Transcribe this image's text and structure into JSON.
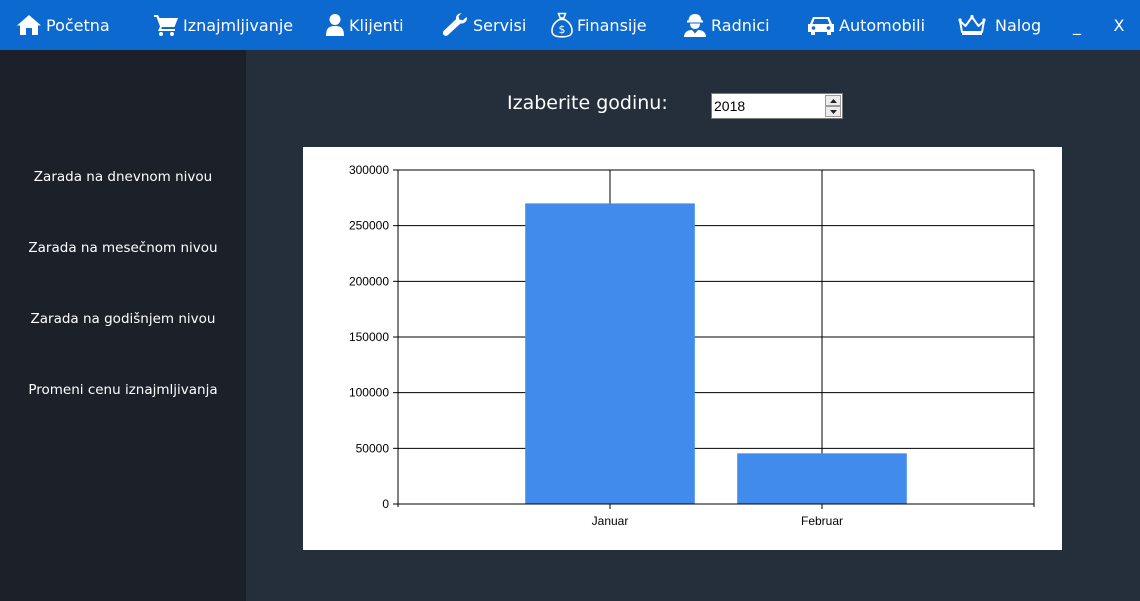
{
  "navbar": {
    "items": [
      {
        "label": "Početna",
        "icon": "home-icon"
      },
      {
        "label": "Iznajmljivanje",
        "icon": "cart-icon"
      },
      {
        "label": "Klijenti",
        "icon": "user-icon"
      },
      {
        "label": "Servisi",
        "icon": "wrench-icon"
      },
      {
        "label": "Finansije",
        "icon": "money-bag-icon"
      },
      {
        "label": "Radnici",
        "icon": "worker-icon"
      },
      {
        "label": "Automobili",
        "icon": "car-icon"
      },
      {
        "label": "Nalog",
        "icon": "crown-icon"
      }
    ],
    "minimize": "_",
    "close": "X",
    "color": "#0b69cf"
  },
  "sidebar": {
    "items": [
      {
        "label": "Zarada na dnevnom nivou"
      },
      {
        "label": "Zarada na mesečnom nivou"
      },
      {
        "label": "Zarada na godišnjem nivou"
      },
      {
        "label": "Promeni cenu iznajmljivanja"
      }
    ]
  },
  "year_selector": {
    "label": "Izaberite godinu:",
    "value": "2018"
  },
  "chart_data": {
    "type": "bar",
    "categories": [
      "Januar",
      "Februar"
    ],
    "values": [
      270000,
      45500
    ],
    "ylim": [
      0,
      300000
    ],
    "yticks": [
      0,
      50000,
      100000,
      150000,
      200000,
      250000,
      300000
    ],
    "grid": true,
    "bar_color": "#418bec"
  }
}
